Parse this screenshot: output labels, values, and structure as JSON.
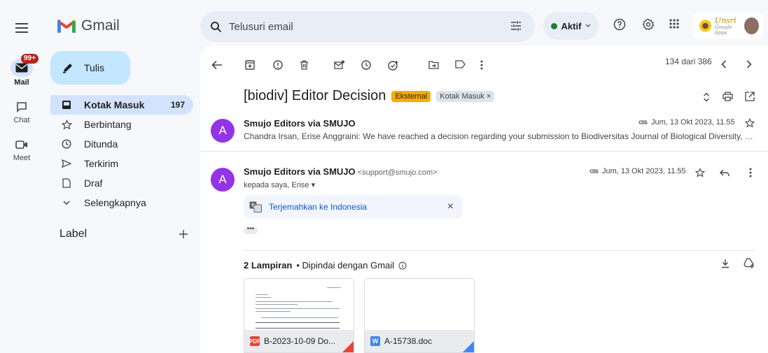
{
  "rail": {
    "mail_label": "Mail",
    "mail_badge": "99+",
    "chat_label": "Chat",
    "meet_label": "Meet"
  },
  "brand": {
    "name": "Gmail"
  },
  "compose": {
    "label": "Tulis"
  },
  "nav": [
    {
      "label": "Kotak Masuk",
      "count": "197",
      "icon": "inbox-icon"
    },
    {
      "label": "Berbintang",
      "count": "",
      "icon": "star-icon"
    },
    {
      "label": "Ditunda",
      "count": "",
      "icon": "clock-icon"
    },
    {
      "label": "Terkirim",
      "count": "",
      "icon": "send-icon"
    },
    {
      "label": "Draf",
      "count": "",
      "icon": "draft-icon"
    },
    {
      "label": "Selengkapnya",
      "count": "",
      "icon": "chevron-down-icon"
    }
  ],
  "labels": {
    "title": "Label"
  },
  "search": {
    "placeholder": "Telusuri email"
  },
  "status": {
    "label": "Aktif"
  },
  "account": {
    "logo_text_1": "Unsri",
    "logo_text_2": "Google Apps"
  },
  "toolbar": {
    "pager": "134 dari 386"
  },
  "thread": {
    "subject": "[biodiv] Editor Decision",
    "chip_external": "Eksternal",
    "chip_inbox": "Kotak Masuk",
    "chip_close": "×",
    "messages": [
      {
        "avatar": "A",
        "sender": "Smujo Editors via SMUJO",
        "date": "Jum, 13 Okt 2023, 11.55",
        "snippet": "Chandra Irsan, Erise Anggraini: We have reached a decision regarding your submission to Biodiversitas Journal of Biological Diversity, \"Specie…"
      },
      {
        "avatar": "A",
        "sender": "Smujo Editors via SMUJO",
        "email": "<support@smujo.com>",
        "date": "Jum, 13 Okt 2023, 11.55",
        "to": "kepada saya, Erise ▾"
      }
    ],
    "translate": {
      "label": "Terjemahkan ke Indonesia",
      "close": "×"
    },
    "ellipsis": "•••",
    "attachments": {
      "count_label": "2 Lampiran",
      "scanned_label": "• Dipindai dengan Gmail",
      "files": [
        {
          "name": "B-2023-10-09 Do...",
          "type": "PDF",
          "color": "#ea4335"
        },
        {
          "name": "A-15738.doc",
          "type": "W",
          "color": "#4285f4"
        }
      ]
    }
  },
  "colors": {
    "background": "#f6f8fc",
    "compose": "#c2e7ff",
    "nav_active": "#d3e3fd",
    "avatar": "#9334e6",
    "chip_external": "#f9ab00",
    "status_dot": "#188038"
  }
}
